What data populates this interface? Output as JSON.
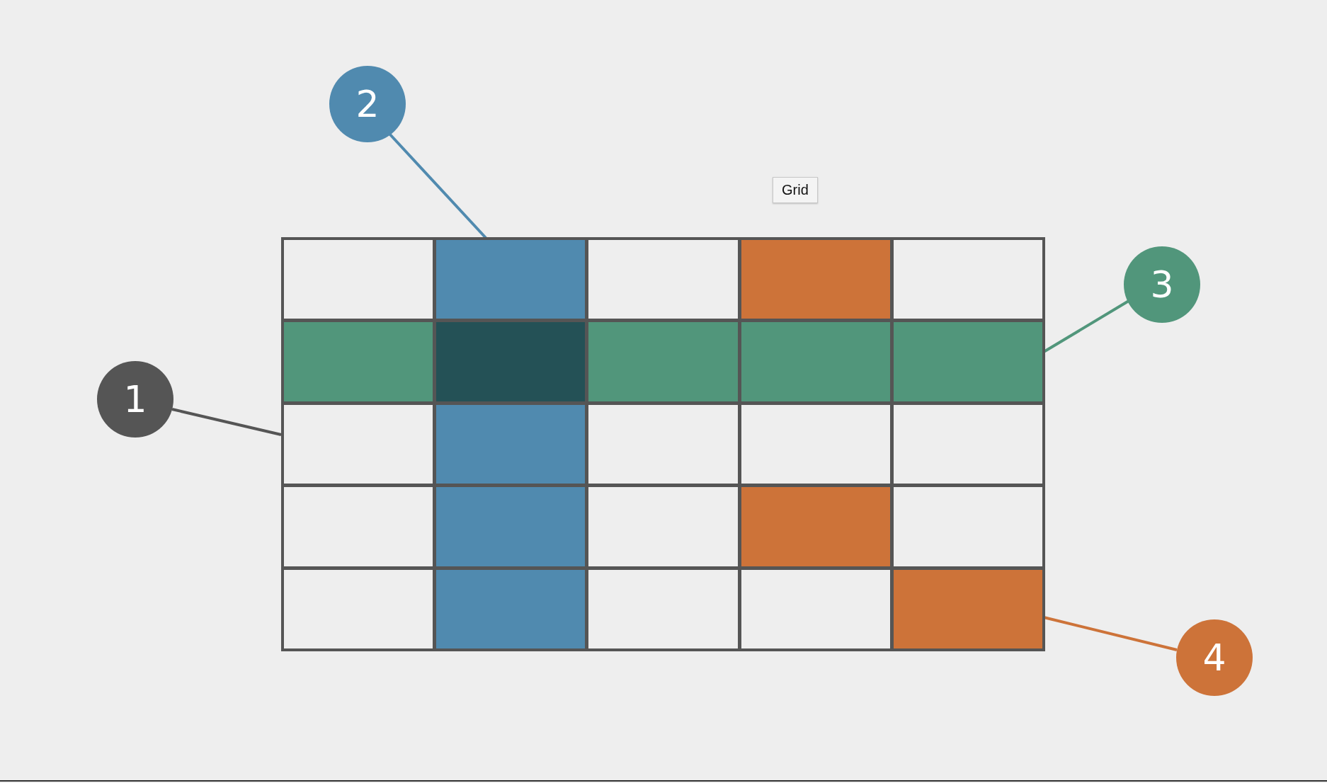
{
  "tooltip": {
    "text": "Grid"
  },
  "grid": {
    "rows": [
      {
        "cells": [
          {
            "color": "#eeeeee"
          },
          {
            "color": "#508aaf"
          },
          {
            "color": "#eeeeee"
          },
          {
            "color": "#cd7339"
          },
          {
            "color": "#eeeeee"
          }
        ]
      },
      {
        "cells": [
          {
            "color": "#51967b"
          },
          {
            "color": "#245156"
          },
          {
            "color": "#51967b"
          },
          {
            "color": "#51967b"
          },
          {
            "color": "#51967b"
          }
        ]
      },
      {
        "cells": [
          {
            "color": "#eeeeee"
          },
          {
            "color": "#508aaf"
          },
          {
            "color": "#eeeeee"
          },
          {
            "color": "#eeeeee"
          },
          {
            "color": "#eeeeee"
          }
        ]
      },
      {
        "cells": [
          {
            "color": "#eeeeee"
          },
          {
            "color": "#508aaf"
          },
          {
            "color": "#eeeeee"
          },
          {
            "color": "#cd7339"
          },
          {
            "color": "#eeeeee"
          }
        ]
      },
      {
        "cells": [
          {
            "color": "#eeeeee"
          },
          {
            "color": "#508aaf"
          },
          {
            "color": "#eeeeee"
          },
          {
            "color": "#eeeeee"
          },
          {
            "color": "#cd7339"
          }
        ]
      }
    ]
  },
  "callouts": [
    {
      "label": "1",
      "color": "#555555"
    },
    {
      "label": "2",
      "color": "#508aaf"
    },
    {
      "label": "3",
      "color": "#51967b"
    },
    {
      "label": "4",
      "color": "#cd7339"
    }
  ]
}
